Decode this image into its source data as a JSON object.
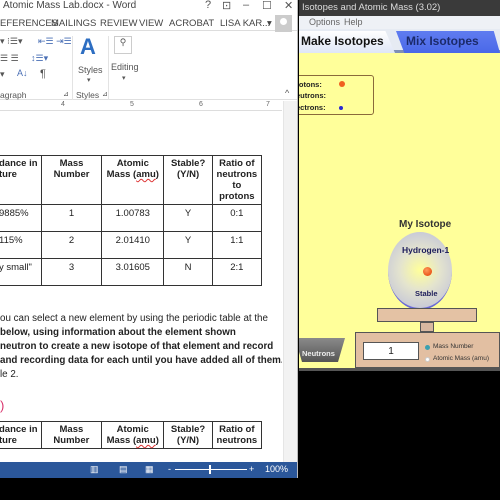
{
  "word": {
    "title": "Atomic Mass Lab.docx - Word",
    "title_controls": {
      "help": "?",
      "ribbon_display": "⊡",
      "minimize": "–",
      "maximize": "☐",
      "close": "✕"
    },
    "tabs": [
      "EFERENCES",
      "MAILINGS",
      "REVIEW",
      "VIEW",
      "ACROBAT"
    ],
    "user": "LISA KAR...",
    "ribbon": {
      "groups": {
        "paragraph": "agraph",
        "styles": "Styles"
      },
      "styles_button": "Styles",
      "editing_button": "Editing"
    },
    "ruler_marks": [
      "4",
      "5",
      "6",
      "7"
    ],
    "table1": {
      "headers": [
        "dance in\nture",
        "Mass\nNumber",
        "Atomic\nMass (amu)",
        "Stable?\n(Y/N)",
        "Ratio of\nneutrons\nto\nprotons"
      ],
      "rows": [
        [
          "9885%",
          "1",
          "1.00783",
          "Y",
          "0:1"
        ],
        [
          "115%",
          "2",
          "2.01410",
          "Y",
          "1:1"
        ],
        [
          "y small\"",
          "3",
          "3.01605",
          "N",
          "2:1"
        ]
      ]
    },
    "paragraph_lines": [
      "ou can select a new element by using the periodic table at the",
      "below, using information about the element shown",
      "neutron to create a new isotope of that element and record",
      "and recording data for each until you have added all of them.",
      "le 2."
    ],
    "annotation_mark": ")",
    "table2": {
      "headers": [
        "dance in\nture",
        "Mass\nNumber",
        "Atomic\nMass (amu)",
        "Stable?\n(Y/N)",
        "Ratio of\nneutrons"
      ]
    },
    "status": {
      "zoom": "100%",
      "zoom_out": "-",
      "zoom_in": "+",
      "zoom_level_percent": 100
    }
  },
  "sim": {
    "title": "Isotopes and Atomic Mass (3.02)",
    "menu": [
      "Options",
      "Help"
    ],
    "tabs": {
      "make": "Make Isotopes",
      "mix": "Mix Isotopes"
    },
    "legend": {
      "protons": "rotons:",
      "neutrons": "eutrons:",
      "electrons": "ectrons:"
    },
    "colors": {
      "proton": "#f06020",
      "electron": "#2a2ad0",
      "background": "#ffff9a",
      "mix_tab": "#4a68e8"
    },
    "isotope_title": "My Isotope",
    "isotope_name": "Hydrogen-1",
    "isotope_status": "Stable",
    "scale_readout": "1",
    "radio": {
      "mass_number": "Mass Number",
      "atomic_mass": "Atomic Mass (amu)",
      "selected": "Mass Number"
    },
    "bucket_label": "Neutrons"
  }
}
